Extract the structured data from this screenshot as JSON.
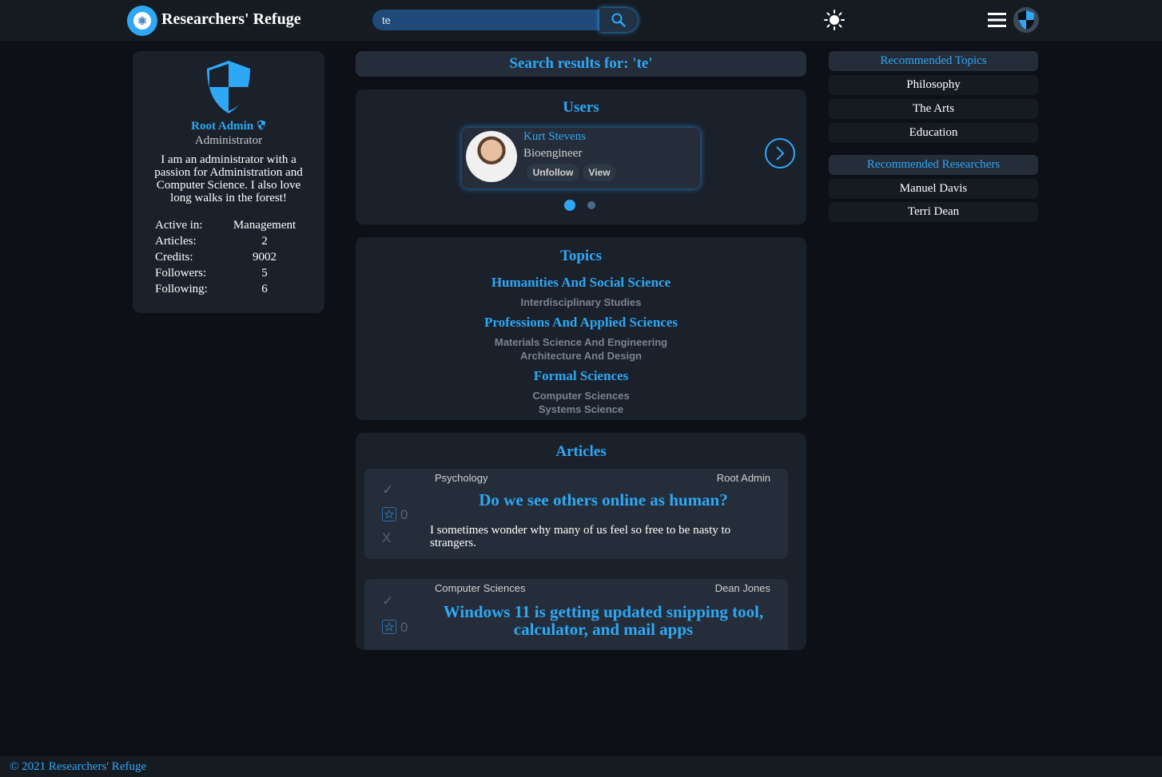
{
  "header": {
    "site_title": "Researchers' Refuge",
    "search_value": "te",
    "logo_icon": "atom-logo-icon",
    "theme_icon": "sun-icon",
    "menu_icon": "hamburger-menu-icon"
  },
  "profile": {
    "name": "Root Admin",
    "role": "Administrator",
    "bio": "I am an administrator with a passion for Administration and Computer Science. I also love long walks in the forest!",
    "stats": [
      {
        "label": "Active in:",
        "value": "Management"
      },
      {
        "label": "Articles:",
        "value": "2"
      },
      {
        "label": "Credits:",
        "value": "9002"
      },
      {
        "label": "Followers:",
        "value": "5"
      },
      {
        "label": "Following:",
        "value": "6"
      }
    ]
  },
  "search": {
    "heading": "Search results for: 'te'"
  },
  "users": {
    "title": "Users",
    "card": {
      "name": "Kurt Stevens",
      "job": "Bioengineer",
      "unfollow_label": "Unfollow",
      "view_label": "View"
    },
    "page_count": 2,
    "active_page": 1
  },
  "topics": {
    "title": "Topics",
    "groups": [
      {
        "name": "Humanities And Social Science",
        "subs": [
          "Interdisciplinary Studies"
        ]
      },
      {
        "name": "Professions And Applied Sciences",
        "subs": [
          "Materials Science And Engineering",
          "Architecture And Design"
        ]
      },
      {
        "name": "Formal Sciences",
        "subs": [
          "Computer Sciences",
          "Systems Science"
        ]
      }
    ]
  },
  "articles": {
    "title": "Articles",
    "items": [
      {
        "category": "Psychology",
        "author": "Root Admin",
        "title": "Do we see others online as human?",
        "body": "I sometimes wonder why many of us feel so free to be nasty to strangers.",
        "score": "0"
      },
      {
        "category": "Computer Sciences",
        "author": "Dean Jones",
        "title": "Windows 11 is getting updated snipping tool, calculator, and mail apps",
        "body": "",
        "score": "0"
      }
    ]
  },
  "sidebar": {
    "topics_heading": "Recommended Topics",
    "topics": [
      "Philosophy",
      "The Arts",
      "Education"
    ],
    "researchers_heading": "Recommended Researchers",
    "researchers": [
      "Manuel Davis",
      "Terri Dean"
    ]
  },
  "footer": {
    "text": "© 2021 Researchers' Refuge"
  },
  "colors": {
    "accent": "#2ea8f5",
    "background": "#0d1117",
    "panel": "#1a212b"
  }
}
